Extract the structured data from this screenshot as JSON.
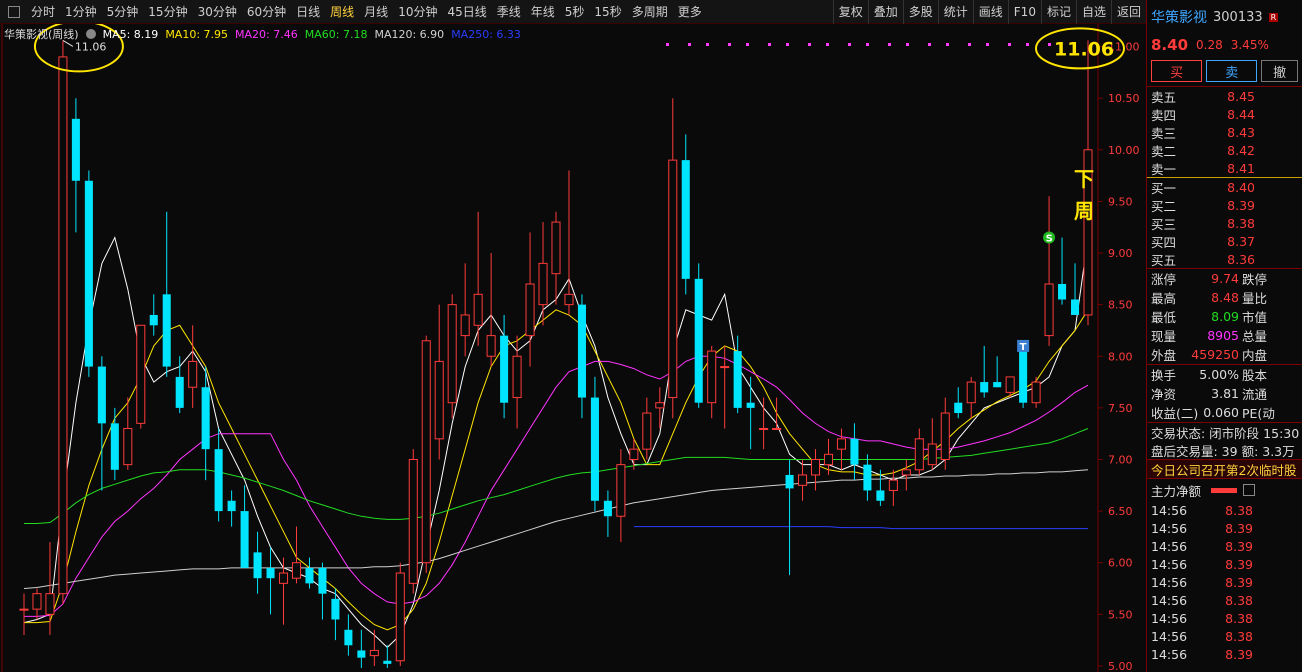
{
  "toolbar": {
    "periods": [
      "分时",
      "1分钟",
      "5分钟",
      "15分钟",
      "30分钟",
      "60分钟",
      "日线",
      "周线",
      "月线",
      "10分钟",
      "45日线",
      "季线",
      "年线",
      "5秒",
      "15秒",
      "多周期",
      "更多"
    ],
    "active": "周线",
    "right": [
      "复权",
      "叠加",
      "多股",
      "统计",
      "画线",
      "F10",
      "标记",
      "自选",
      "返回"
    ]
  },
  "legend": {
    "title": "华策影视(周线)",
    "ma": [
      {
        "label": "MA5: 8.19",
        "color": "#ffffff"
      },
      {
        "label": "MA10: 7.95",
        "color": "#ffe500"
      },
      {
        "label": "MA20: 7.46",
        "color": "#ff34ff"
      },
      {
        "label": "MA60: 7.18",
        "color": "#22dd22"
      },
      {
        "label": "MA120: 6.90",
        "color": "#d0d0d0"
      },
      {
        "label": "MA250: 6.33",
        "color": "#2a3cff"
      }
    ]
  },
  "annotations": {
    "high_left": "11.06",
    "high_right": "11.06",
    "next_week": [
      "下",
      "周"
    ],
    "signal_s": "S",
    "signal_t": "T"
  },
  "chart_data": {
    "type": "candlestick",
    "period": "weekly",
    "yaxis_ticks": [
      "11.00",
      "10.50",
      "10.00",
      "9.50",
      "9.00",
      "8.50",
      "8.00",
      "7.50",
      "7.00",
      "6.50",
      "6.00",
      "5.50",
      "5.00"
    ],
    "ylim": [
      4.98,
      11.18
    ],
    "candles": [
      {
        "o": 5.55,
        "h": 5.7,
        "l": 5.3,
        "c": 5.55
      },
      {
        "o": 5.55,
        "h": 5.75,
        "l": 5.45,
        "c": 5.7
      },
      {
        "o": 5.5,
        "h": 6.2,
        "l": 5.3,
        "c": 5.7
      },
      {
        "o": 5.7,
        "h": 11.06,
        "l": 5.6,
        "c": 10.9
      },
      {
        "o": 10.3,
        "h": 10.5,
        "l": 9.2,
        "c": 9.7
      },
      {
        "o": 9.7,
        "h": 9.8,
        "l": 7.8,
        "c": 7.9
      },
      {
        "o": 7.9,
        "h": 8.0,
        "l": 6.7,
        "c": 7.35
      },
      {
        "o": 7.35,
        "h": 7.5,
        "l": 6.8,
        "c": 6.9
      },
      {
        "o": 6.95,
        "h": 7.6,
        "l": 6.9,
        "c": 7.3
      },
      {
        "o": 7.35,
        "h": 8.3,
        "l": 7.3,
        "c": 8.3
      },
      {
        "o": 8.4,
        "h": 8.6,
        "l": 8.2,
        "c": 8.3
      },
      {
        "o": 8.6,
        "h": 9.4,
        "l": 7.8,
        "c": 7.9
      },
      {
        "o": 7.8,
        "h": 8.0,
        "l": 7.45,
        "c": 7.5
      },
      {
        "o": 7.7,
        "h": 8.3,
        "l": 7.5,
        "c": 7.95
      },
      {
        "o": 7.7,
        "h": 7.9,
        "l": 6.8,
        "c": 7.1
      },
      {
        "o": 7.1,
        "h": 7.3,
        "l": 6.4,
        "c": 6.5
      },
      {
        "o": 6.6,
        "h": 6.7,
        "l": 6.35,
        "c": 6.5
      },
      {
        "o": 6.5,
        "h": 6.75,
        "l": 5.95,
        "c": 5.95
      },
      {
        "o": 6.1,
        "h": 6.3,
        "l": 5.7,
        "c": 5.85
      },
      {
        "o": 5.95,
        "h": 6.15,
        "l": 5.5,
        "c": 5.85
      },
      {
        "o": 5.8,
        "h": 6.05,
        "l": 5.4,
        "c": 5.9
      },
      {
        "o": 5.85,
        "h": 6.35,
        "l": 5.8,
        "c": 6.0
      },
      {
        "o": 5.95,
        "h": 6.05,
        "l": 5.75,
        "c": 5.8
      },
      {
        "o": 5.95,
        "h": 6.0,
        "l": 5.45,
        "c": 5.7
      },
      {
        "o": 5.65,
        "h": 5.75,
        "l": 5.25,
        "c": 5.45
      },
      {
        "o": 5.35,
        "h": 5.5,
        "l": 5.1,
        "c": 5.2
      },
      {
        "o": 5.15,
        "h": 5.35,
        "l": 4.98,
        "c": 5.08
      },
      {
        "o": 5.1,
        "h": 5.35,
        "l": 5.0,
        "c": 5.15
      },
      {
        "o": 5.05,
        "h": 5.2,
        "l": 4.98,
        "c": 5.02
      },
      {
        "o": 5.05,
        "h": 6.0,
        "l": 5.0,
        "c": 5.9
      },
      {
        "o": 5.8,
        "h": 7.1,
        "l": 5.7,
        "c": 7.0
      },
      {
        "o": 6.0,
        "h": 8.2,
        "l": 5.9,
        "c": 8.15
      },
      {
        "o": 7.2,
        "h": 8.5,
        "l": 7.0,
        "c": 7.95
      },
      {
        "o": 7.55,
        "h": 8.6,
        "l": 7.4,
        "c": 8.5
      },
      {
        "o": 8.2,
        "h": 8.9,
        "l": 8.0,
        "c": 8.4
      },
      {
        "o": 8.3,
        "h": 9.4,
        "l": 8.1,
        "c": 8.6
      },
      {
        "o": 8.0,
        "h": 9.0,
        "l": 7.9,
        "c": 8.2
      },
      {
        "o": 8.2,
        "h": 8.4,
        "l": 7.4,
        "c": 7.55
      },
      {
        "o": 7.6,
        "h": 8.2,
        "l": 7.3,
        "c": 8.0
      },
      {
        "o": 8.2,
        "h": 9.2,
        "l": 7.9,
        "c": 8.7
      },
      {
        "o": 8.5,
        "h": 9.3,
        "l": 8.3,
        "c": 8.9
      },
      {
        "o": 8.8,
        "h": 9.4,
        "l": 8.5,
        "c": 9.3
      },
      {
        "o": 8.5,
        "h": 9.8,
        "l": 8.4,
        "c": 8.6
      },
      {
        "o": 8.5,
        "h": 8.6,
        "l": 7.4,
        "c": 7.6
      },
      {
        "o": 7.6,
        "h": 7.8,
        "l": 6.5,
        "c": 6.6
      },
      {
        "o": 6.6,
        "h": 6.7,
        "l": 6.25,
        "c": 6.45
      },
      {
        "o": 6.45,
        "h": 7.1,
        "l": 6.2,
        "c": 6.95
      },
      {
        "o": 7.0,
        "h": 7.2,
        "l": 6.9,
        "c": 7.1
      },
      {
        "o": 7.1,
        "h": 7.6,
        "l": 7.0,
        "c": 7.45
      },
      {
        "o": 7.5,
        "h": 7.7,
        "l": 7.3,
        "c": 7.55
      },
      {
        "o": 7.6,
        "h": 10.5,
        "l": 7.4,
        "c": 9.9
      },
      {
        "o": 9.9,
        "h": 10.15,
        "l": 8.6,
        "c": 8.75
      },
      {
        "o": 8.75,
        "h": 8.9,
        "l": 7.5,
        "c": 7.55
      },
      {
        "o": 7.55,
        "h": 8.1,
        "l": 7.4,
        "c": 8.05
      },
      {
        "o": 7.9,
        "h": 8.1,
        "l": 7.3,
        "c": 7.9
      },
      {
        "o": 8.05,
        "h": 8.2,
        "l": 7.45,
        "c": 7.5
      },
      {
        "o": 7.55,
        "h": 7.8,
        "l": 7.1,
        "c": 7.5
      },
      {
        "o": 7.3,
        "h": 7.6,
        "l": 7.1,
        "c": 7.3
      },
      {
        "o": 7.3,
        "h": 7.6,
        "l": 7.3,
        "c": 7.3
      },
      {
        "o": 6.85,
        "h": 7.0,
        "l": 5.88,
        "c": 6.72
      },
      {
        "o": 6.75,
        "h": 7.0,
        "l": 6.6,
        "c": 6.85
      },
      {
        "o": 6.85,
        "h": 7.1,
        "l": 6.7,
        "c": 7.0
      },
      {
        "o": 6.95,
        "h": 7.2,
        "l": 6.85,
        "c": 7.05
      },
      {
        "o": 7.1,
        "h": 7.3,
        "l": 6.9,
        "c": 7.2
      },
      {
        "o": 7.2,
        "h": 7.35,
        "l": 6.8,
        "c": 6.95
      },
      {
        "o": 6.95,
        "h": 7.05,
        "l": 6.6,
        "c": 6.7
      },
      {
        "o": 6.7,
        "h": 6.9,
        "l": 6.55,
        "c": 6.6
      },
      {
        "o": 6.7,
        "h": 6.9,
        "l": 6.55,
        "c": 6.8
      },
      {
        "o": 6.85,
        "h": 7.0,
        "l": 6.7,
        "c": 6.9
      },
      {
        "o": 6.9,
        "h": 7.3,
        "l": 6.85,
        "c": 7.2
      },
      {
        "o": 6.95,
        "h": 7.4,
        "l": 6.9,
        "c": 7.15
      },
      {
        "o": 7.0,
        "h": 7.6,
        "l": 6.9,
        "c": 7.45
      },
      {
        "o": 7.55,
        "h": 7.7,
        "l": 7.4,
        "c": 7.45
      },
      {
        "o": 7.55,
        "h": 7.8,
        "l": 7.4,
        "c": 7.75
      },
      {
        "o": 7.75,
        "h": 8.1,
        "l": 7.6,
        "c": 7.65
      },
      {
        "o": 7.75,
        "h": 8.0,
        "l": 7.7,
        "c": 7.7
      },
      {
        "o": 7.65,
        "h": 7.8,
        "l": 7.6,
        "c": 7.8
      },
      {
        "o": 8.05,
        "h": 8.15,
        "l": 7.5,
        "c": 7.55
      },
      {
        "o": 7.55,
        "h": 7.8,
        "l": 7.5,
        "c": 7.75
      },
      {
        "o": 8.2,
        "h": 9.55,
        "l": 8.1,
        "c": 8.7
      },
      {
        "o": 8.7,
        "h": 9.15,
        "l": 8.5,
        "c": 8.55
      },
      {
        "o": 8.55,
        "h": 8.9,
        "l": 8.4,
        "c": 8.4
      },
      {
        "o": 8.4,
        "h": 11.06,
        "l": 8.3,
        "c": 10.0
      }
    ],
    "ma_series": [
      {
        "name": "MA5",
        "color": "#ffffff",
        "values": [
          5.42,
          5.45,
          5.5,
          6.6,
          7.55,
          8.3,
          8.9,
          9.15,
          8.65,
          8.0,
          7.75,
          7.85,
          7.9,
          8.05,
          7.85,
          7.3,
          7.05,
          6.8,
          6.45,
          6.15,
          5.95,
          5.9,
          5.85,
          5.75,
          5.7,
          5.55,
          5.4,
          5.3,
          5.18,
          5.3,
          5.6,
          6.15,
          6.7,
          7.35,
          7.9,
          8.25,
          8.4,
          8.2,
          8.05,
          8.15,
          8.45,
          8.55,
          8.75,
          8.4,
          8.1,
          7.6,
          7.25,
          6.95,
          6.95,
          7.25,
          8.05,
          8.45,
          8.4,
          8.35,
          8.6,
          7.9,
          7.7,
          7.5,
          7.35,
          7.05,
          6.95,
          6.95,
          6.95,
          6.9,
          6.95,
          6.9,
          6.85,
          6.8,
          6.85,
          6.85,
          6.9,
          7.0,
          7.2,
          7.35,
          7.5,
          7.55,
          7.6,
          7.65,
          7.7,
          7.8,
          8.1,
          8.25,
          9.15
        ]
      },
      {
        "name": "MA10",
        "color": "#ffe500",
        "values": [
          5.42,
          5.42,
          5.43,
          5.8,
          6.3,
          6.75,
          7.1,
          7.4,
          7.55,
          7.8,
          8.1,
          8.25,
          8.3,
          8.1,
          7.9,
          7.55,
          7.3,
          7.05,
          6.8,
          6.55,
          6.3,
          6.05,
          5.95,
          5.85,
          5.75,
          5.62,
          5.5,
          5.4,
          5.35,
          5.4,
          5.55,
          5.8,
          6.2,
          6.65,
          7.1,
          7.55,
          7.9,
          8.1,
          8.15,
          8.25,
          8.35,
          8.45,
          8.4,
          8.3,
          8.05,
          7.8,
          7.55,
          7.2,
          6.95,
          6.95,
          7.25,
          7.55,
          7.8,
          8.0,
          8.1,
          8.05,
          7.9,
          7.7,
          7.45,
          7.25,
          7.1,
          6.95,
          6.9,
          6.88,
          6.88,
          6.85,
          6.85,
          6.87,
          6.92,
          6.98,
          7.08,
          7.18,
          7.3,
          7.4,
          7.48,
          7.56,
          7.62,
          7.68,
          7.76,
          7.95,
          8.1,
          8.25,
          8.45
        ]
      },
      {
        "name": "MA20",
        "color": "#ff34ff",
        "values": [
          5.48,
          5.48,
          5.49,
          5.6,
          5.85,
          6.05,
          6.25,
          6.4,
          6.5,
          6.62,
          6.72,
          6.85,
          7.0,
          7.1,
          7.2,
          7.25,
          7.25,
          7.25,
          7.25,
          7.25,
          7.0,
          6.8,
          6.55,
          6.35,
          6.15,
          5.95,
          5.8,
          5.7,
          5.62,
          5.6,
          5.62,
          5.68,
          5.8,
          5.98,
          6.2,
          6.45,
          6.7,
          6.9,
          7.1,
          7.3,
          7.5,
          7.7,
          7.85,
          7.9,
          7.95,
          7.95,
          7.92,
          7.88,
          7.82,
          7.78,
          7.85,
          7.95,
          8.0,
          8.0,
          7.98,
          7.92,
          7.85,
          7.78,
          7.7,
          7.58,
          7.45,
          7.35,
          7.27,
          7.22,
          7.2,
          7.18,
          7.18,
          7.15,
          7.12,
          7.1,
          7.1,
          7.1,
          7.12,
          7.15,
          7.18,
          7.22,
          7.26,
          7.32,
          7.38,
          7.46,
          7.55,
          7.65,
          7.72
        ]
      },
      {
        "name": "MA60",
        "color": "#22dd22",
        "values": [
          6.38,
          6.38,
          6.39,
          6.48,
          6.58,
          6.66,
          6.72,
          6.76,
          6.8,
          6.84,
          6.87,
          6.88,
          6.9,
          6.9,
          6.9,
          6.88,
          6.85,
          6.82,
          6.78,
          6.74,
          6.7,
          6.65,
          6.6,
          6.56,
          6.52,
          6.48,
          6.45,
          6.43,
          6.42,
          6.42,
          6.43,
          6.45,
          6.48,
          6.52,
          6.56,
          6.6,
          6.63,
          6.66,
          6.7,
          6.74,
          6.78,
          6.82,
          6.85,
          6.87,
          6.88,
          6.9,
          6.92,
          6.94,
          6.96,
          6.98,
          7.0,
          7.02,
          7.02,
          7.02,
          7.02,
          7.01,
          7.0,
          7.0,
          7.0,
          7.0,
          7.0,
          7.0,
          7.0,
          7.0,
          7.0,
          7.0,
          7.0,
          7.0,
          7.0,
          7.0,
          7.01,
          7.02,
          7.03,
          7.04,
          7.06,
          7.08,
          7.1,
          7.12,
          7.14,
          7.16,
          7.2,
          7.25,
          7.3
        ]
      },
      {
        "name": "MA120",
        "color": "#d0d0d0",
        "values": [
          5.75,
          5.76,
          5.78,
          5.8,
          5.82,
          5.84,
          5.86,
          5.88,
          5.89,
          5.9,
          5.91,
          5.92,
          5.93,
          5.94,
          5.94,
          5.94,
          5.95,
          5.95,
          5.95,
          5.95,
          5.95,
          5.95,
          5.95,
          5.95,
          5.95,
          5.95,
          5.95,
          5.96,
          5.96,
          5.97,
          5.99,
          6.01,
          6.04,
          6.08,
          6.12,
          6.16,
          6.2,
          6.24,
          6.28,
          6.32,
          6.36,
          6.4,
          6.43,
          6.46,
          6.49,
          6.52,
          6.55,
          6.58,
          6.6,
          6.62,
          6.64,
          6.66,
          6.68,
          6.7,
          6.71,
          6.72,
          6.73,
          6.74,
          6.75,
          6.76,
          6.77,
          6.78,
          6.79,
          6.8,
          6.8,
          6.81,
          6.81,
          6.82,
          6.82,
          6.83,
          6.83,
          6.84,
          6.84,
          6.85,
          6.85,
          6.86,
          6.86,
          6.87,
          6.87,
          6.88,
          6.88,
          6.89,
          6.9
        ]
      },
      {
        "name": "MA250",
        "color": "#2a3cff",
        "values": [
          null,
          null,
          null,
          null,
          null,
          null,
          null,
          null,
          null,
          null,
          null,
          null,
          null,
          null,
          null,
          null,
          null,
          null,
          null,
          null,
          null,
          null,
          null,
          null,
          null,
          null,
          null,
          null,
          null,
          null,
          null,
          null,
          null,
          null,
          null,
          null,
          null,
          null,
          null,
          null,
          null,
          null,
          null,
          null,
          null,
          null,
          null,
          6.35,
          6.35,
          6.35,
          6.35,
          6.35,
          6.35,
          6.35,
          6.35,
          6.35,
          6.35,
          6.35,
          6.35,
          6.35,
          6.35,
          6.35,
          6.35,
          6.34,
          6.34,
          6.34,
          6.34,
          6.33,
          6.33,
          6.33,
          6.33,
          6.33,
          6.33,
          6.33,
          6.33,
          6.33,
          6.33,
          6.33,
          6.33,
          6.33,
          6.33,
          6.33,
          6.33
        ]
      }
    ]
  },
  "quote": {
    "name": "华策影视",
    "code": "300133",
    "badge": "R⁠000",
    "price": "8.40",
    "change": "0.28",
    "change_pct": "3.45%",
    "buy_label": "买",
    "sell_label": "卖",
    "cancel_label": "撤",
    "asks": [
      {
        "label": "卖五",
        "price": "8.45"
      },
      {
        "label": "卖四",
        "price": "8.44"
      },
      {
        "label": "卖三",
        "price": "8.43"
      },
      {
        "label": "卖二",
        "price": "8.42"
      },
      {
        "label": "卖一",
        "price": "8.41"
      }
    ],
    "bids": [
      {
        "label": "买一",
        "price": "8.40"
      },
      {
        "label": "买二",
        "price": "8.39"
      },
      {
        "label": "买三",
        "price": "8.38"
      },
      {
        "label": "买四",
        "price": "8.37"
      },
      {
        "label": "买五",
        "price": "8.36"
      }
    ],
    "stats": [
      {
        "k": "涨停",
        "v": "9.74",
        "color": "#ff3b3b",
        "k2": "跌停"
      },
      {
        "k": "最高",
        "v": "8.48",
        "color": "#ff3b3b",
        "k2": "量比"
      },
      {
        "k": "最低",
        "v": "8.09",
        "color": "#22dd22",
        "k2": "市值"
      },
      {
        "k": "现量",
        "v": "8905",
        "color": "#ff34ff",
        "k2": "总量"
      },
      {
        "k": "外盘",
        "v": "459250",
        "color": "#ff3b3b",
        "k2": "内盘"
      }
    ],
    "stats2": [
      {
        "k": "换手",
        "v": "5.00%",
        "k2": "股本"
      },
      {
        "k": "净资",
        "v": "3.81",
        "k2": "流通"
      },
      {
        "k": "收益(二)",
        "v": "0.060",
        "k2": "PE(动"
      }
    ],
    "trade_status": "交易状态: 闭市阶段 15:30",
    "after_hours": "盘后交易量: 39  额: 3.3万",
    "news": "今日公司召开第2次临时股",
    "flow_label": "主力净额",
    "ticks": [
      {
        "t": "14:56",
        "p": "8.38"
      },
      {
        "t": "14:56",
        "p": "8.39"
      },
      {
        "t": "14:56",
        "p": "8.39"
      },
      {
        "t": "14:56",
        "p": "8.39"
      },
      {
        "t": "14:56",
        "p": "8.39"
      },
      {
        "t": "14:56",
        "p": "8.38"
      },
      {
        "t": "14:56",
        "p": "8.38"
      },
      {
        "t": "14:56",
        "p": "8.38"
      },
      {
        "t": "14:56",
        "p": "8.39"
      }
    ]
  }
}
